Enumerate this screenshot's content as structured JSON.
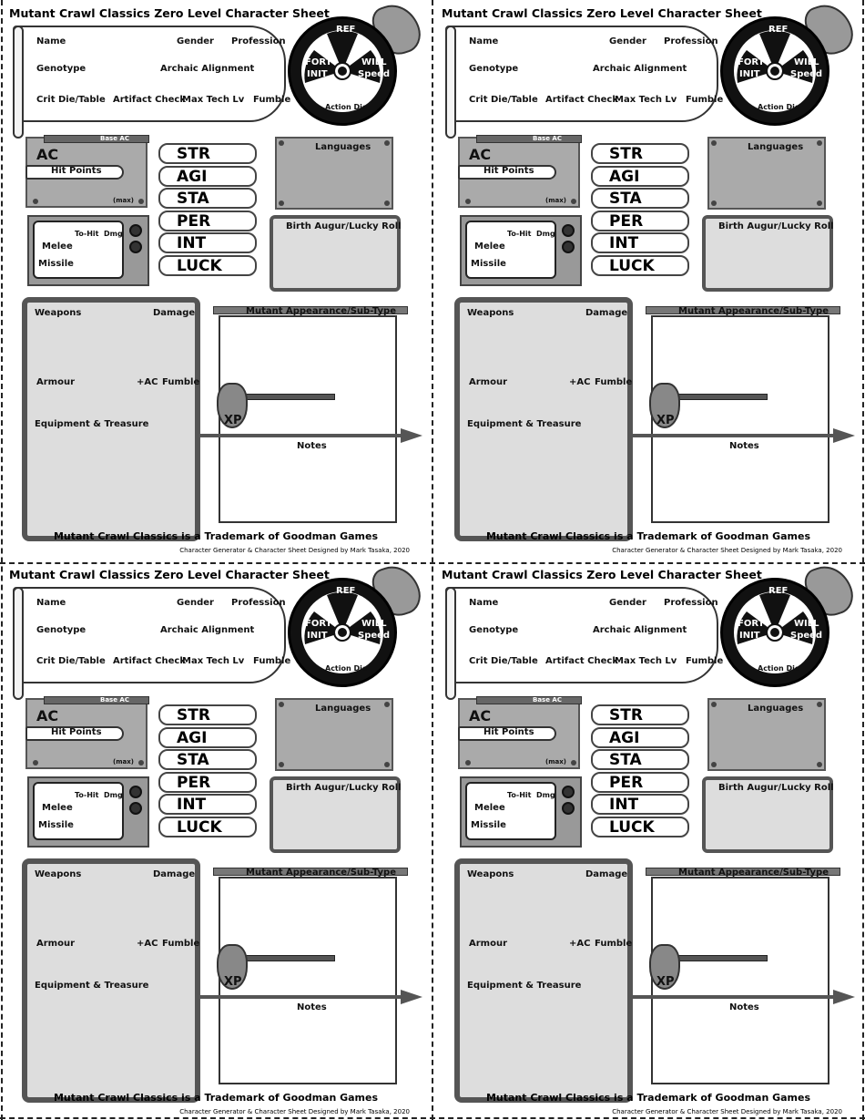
{
  "sheet": {
    "title": "Mutant Crawl Classics Zero Level Character Sheet",
    "fields": {
      "name": "Name",
      "gender": "Gender",
      "profession": "Profession",
      "genotype": "Genotype",
      "alignment": "Archaic Alignment",
      "crit": "Crit Die/Table",
      "artifact": "Artifact Check",
      "maxtech": "Max Tech Lv",
      "fumble": "Fumble"
    },
    "saves": {
      "ref": "REF",
      "fort": "FORT",
      "init": "INIT",
      "will": "WILL",
      "speed": "Speed",
      "action": "Action Die"
    },
    "ac": {
      "base": "Base AC",
      "ac": "AC",
      "hp": "Hit Points",
      "max": "(max)"
    },
    "attack": {
      "tohit": "To-Hit",
      "dmg": "Dmg",
      "melee": "Melee",
      "missile": "Missile"
    },
    "stats": [
      "STR",
      "AGI",
      "STA",
      "PER",
      "INT",
      "LUCK"
    ],
    "languages": "Languages",
    "birth": "Birth Augur/Lucky Roll",
    "weapons": "Weapons",
    "damage": "Damage",
    "armour": "Armour",
    "plusac": "+AC",
    "armfumble": "Fumble",
    "equipment": "Equipment & Treasure",
    "mutant": "Mutant Appearance/Sub-Type",
    "xp": "XP",
    "notes": "Notes",
    "trademark": "Mutant Crawl Classics is a Trademark of Goodman Games",
    "credit": "Character Generator & Character Sheet Designed by Mark Tasaka, 2020"
  },
  "colors": {
    "ink": "#111111",
    "panel": "#aaaaaa",
    "panel_light": "#dddddd",
    "frame": "#555555"
  }
}
